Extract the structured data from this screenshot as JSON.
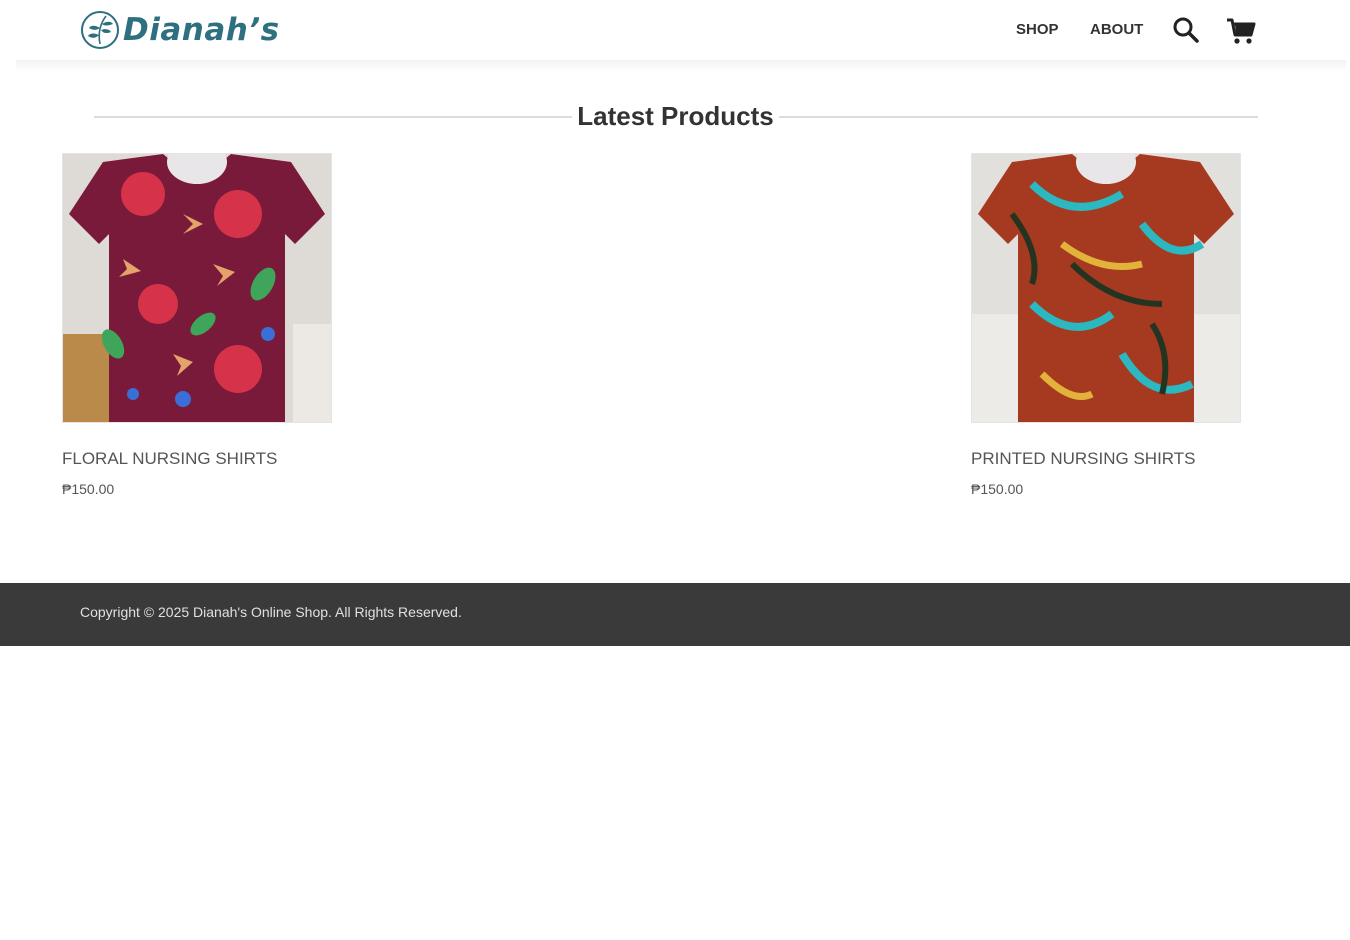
{
  "header": {
    "logo_text": "Dianah’s",
    "nav": {
      "shop": "SHOP",
      "about": "ABOUT"
    },
    "icons": {
      "search": "search-icon",
      "cart": "cart-icon"
    }
  },
  "main": {
    "section_title": "Latest Products",
    "products": [
      {
        "name": "FLORAL NURSING SHIRTS",
        "price": "₱150.00",
        "image": "maroon-floral-shirt"
      },
      {
        "name": "PRINTED NURSING SHIRTS",
        "price": "₱150.00",
        "image": "rust-leaf-print-shirt"
      }
    ]
  },
  "footer": {
    "copyright": "Copyright © 2025 Dianah's Online Shop. All Rights Reserved."
  },
  "colors": {
    "brand": "#2e6f80",
    "footer_bg": "#3a3a3a",
    "text": "#333333"
  }
}
